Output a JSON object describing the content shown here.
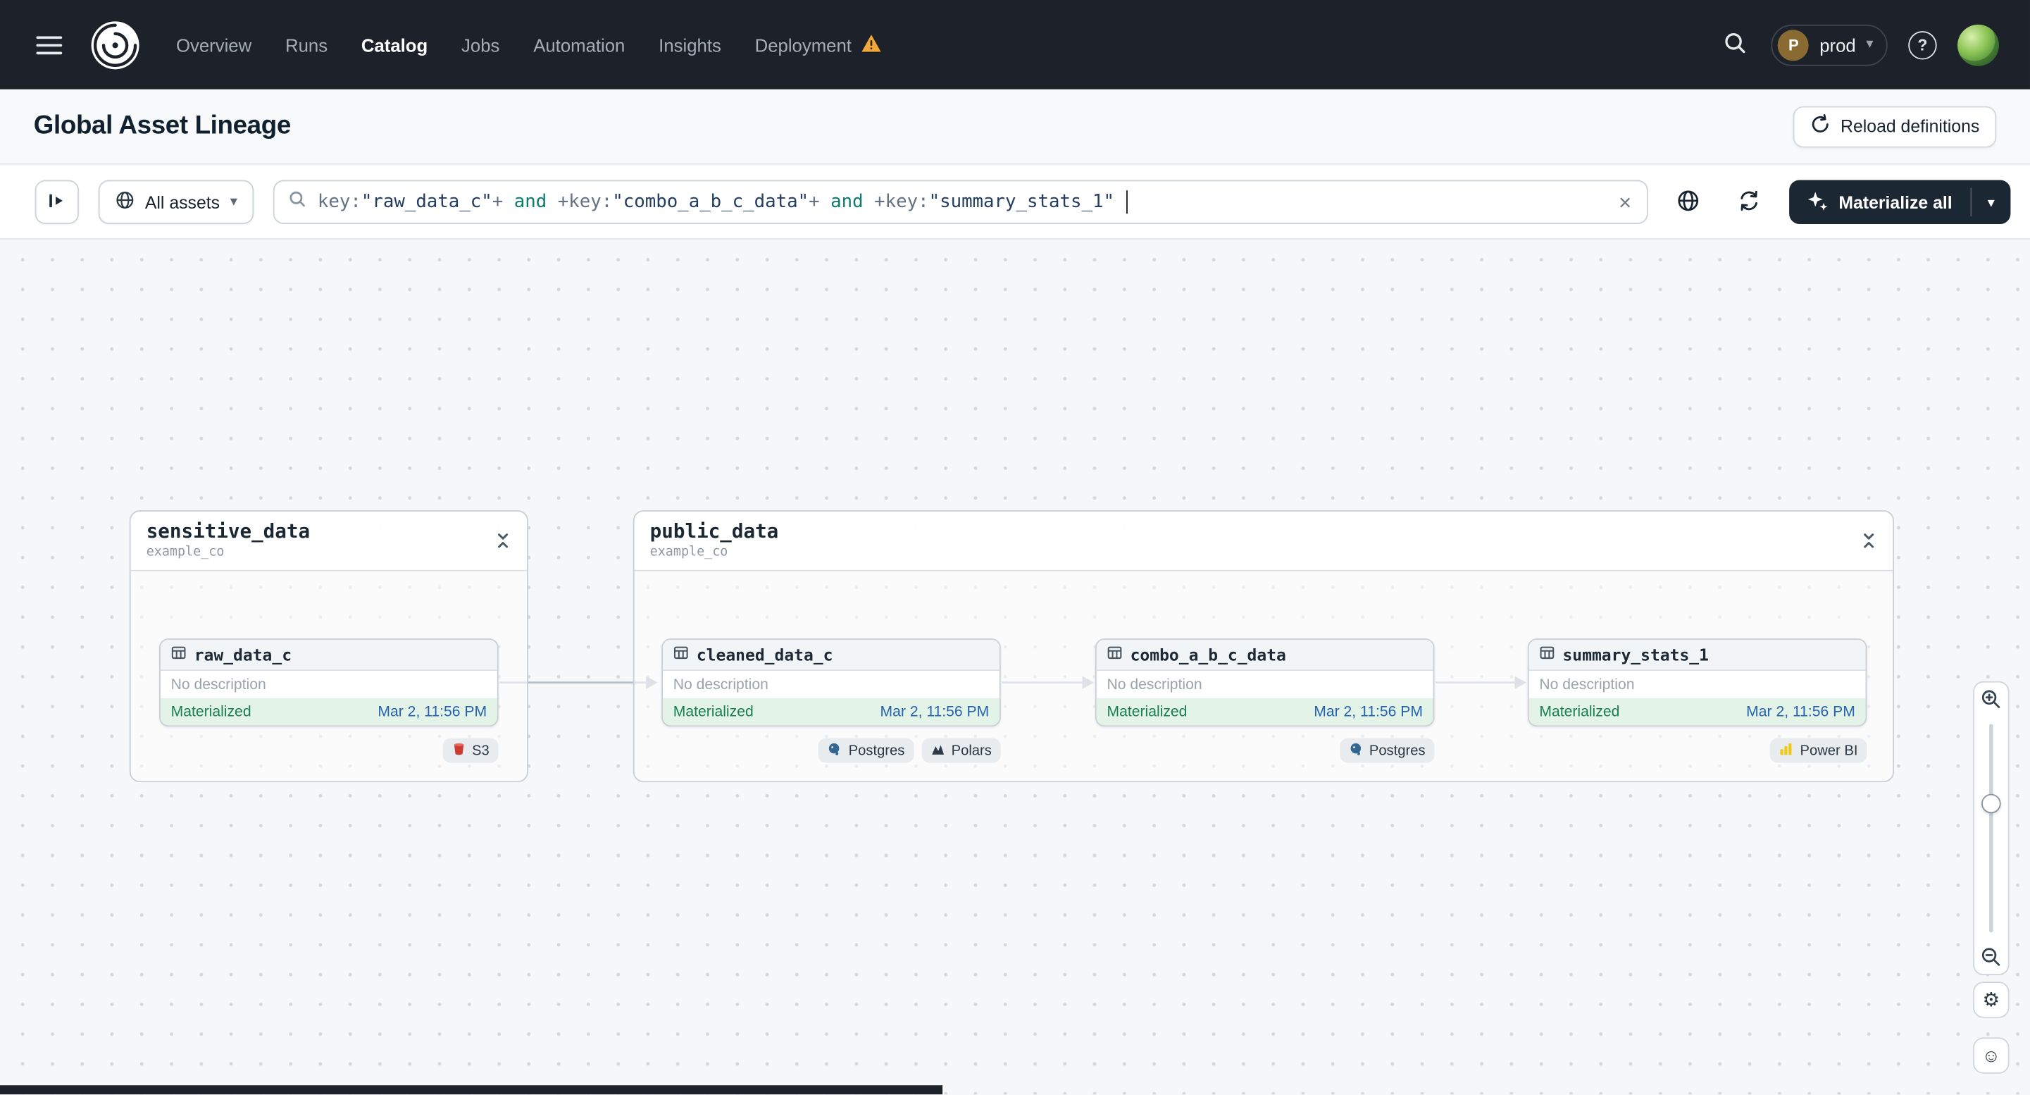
{
  "icons": {
    "chevron_down": "▾",
    "help": "?",
    "close": "×",
    "gear": "⚙",
    "smiley": "☺"
  },
  "nav": {
    "items": [
      {
        "label": "Overview"
      },
      {
        "label": "Runs"
      },
      {
        "label": "Catalog",
        "active": true
      },
      {
        "label": "Jobs"
      },
      {
        "label": "Automation"
      },
      {
        "label": "Insights"
      },
      {
        "label": "Deployment",
        "warning": true
      }
    ],
    "deployment": {
      "initial": "P",
      "name": "prod"
    }
  },
  "header": {
    "title": "Global Asset Lineage",
    "reload_button": "Reload definitions"
  },
  "toolbar": {
    "asset_scope": "All assets",
    "materialize_button": "Materialize all",
    "query_segments": [
      {
        "type": "key",
        "text": "key:"
      },
      {
        "type": "value",
        "text": "\"raw_data_c\""
      },
      {
        "type": "op",
        "text": "+"
      },
      {
        "type": "keyword",
        "text": " and "
      },
      {
        "type": "op",
        "text": "+"
      },
      {
        "type": "key",
        "text": "key:"
      },
      {
        "type": "value",
        "text": "\"combo_a_b_c_data\""
      },
      {
        "type": "op",
        "text": "+"
      },
      {
        "type": "keyword",
        "text": " and "
      },
      {
        "type": "op",
        "text": "+"
      },
      {
        "type": "key",
        "text": "key:"
      },
      {
        "type": "value",
        "text": "\"summary_stats_1\""
      }
    ]
  },
  "canvas": {
    "groups": [
      {
        "name": "sensitive_data",
        "subtitle": "example_co",
        "nodes": [
          {
            "name": "raw_data_c",
            "description": "No description",
            "status": "Materialized",
            "timestamp": "Mar 2, 11:56 PM",
            "tags": [
              {
                "label": "S3",
                "icon": "s3-icon"
              }
            ]
          }
        ]
      },
      {
        "name": "public_data",
        "subtitle": "example_co",
        "nodes": [
          {
            "name": "cleaned_data_c",
            "description": "No description",
            "status": "Materialized",
            "timestamp": "Mar 2, 11:56 PM",
            "tags": [
              {
                "label": "Postgres",
                "icon": "postgres-icon"
              },
              {
                "label": "Polars",
                "icon": "polars-icon"
              }
            ]
          },
          {
            "name": "combo_a_b_c_data",
            "description": "No description",
            "status": "Materialized",
            "timestamp": "Mar 2, 11:56 PM",
            "tags": [
              {
                "label": "Postgres",
                "icon": "postgres-icon"
              }
            ]
          },
          {
            "name": "summary_stats_1",
            "description": "No description",
            "status": "Materialized",
            "timestamp": "Mar 2, 11:56 PM",
            "tags": [
              {
                "label": "Power BI",
                "icon": "powerbi-icon"
              }
            ]
          }
        ]
      }
    ],
    "edges": [
      {
        "from": "raw_data_c",
        "to": "cleaned_data_c"
      },
      {
        "from": "cleaned_data_c",
        "to": "combo_a_b_c_data"
      },
      {
        "from": "combo_a_b_c_data",
        "to": "summary_stats_1"
      }
    ]
  }
}
